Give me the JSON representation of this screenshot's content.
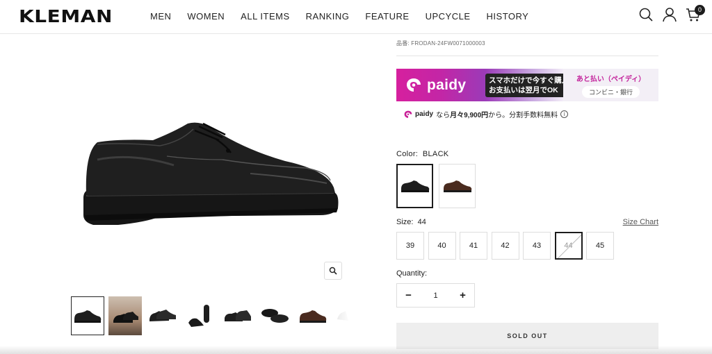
{
  "header": {
    "logo": "KLEMAN",
    "nav": [
      "MEN",
      "WOMEN",
      "ALL ITEMS",
      "RANKING",
      "FEATURE",
      "UPCYCLE",
      "HISTORY"
    ],
    "cart_count": "0",
    "icons": [
      "search-icon",
      "account-icon",
      "cart-icon"
    ]
  },
  "product": {
    "sku": "品番: FRODAN-24FW0071000003",
    "paidy": {
      "brand": "paidy",
      "promo_line1": "スマホだけで今すぐ購入",
      "promo_line2": "お支払いは翌月でOK",
      "label_atobarai": "あと払い（ペイディ）",
      "label_stores": "コンビニ・銀行",
      "line_brand": "paidy",
      "line_prefix": "なら",
      "line_amount": "月々9,900円",
      "line_suffix": "から。分割手数料無料"
    },
    "color_label": "Color:",
    "color_value": "BLACK",
    "colors": [
      "BLACK",
      "BROWN"
    ],
    "size_label": "Size:",
    "size_value": "44",
    "size_chart": "Size Chart",
    "sizes": [
      "39",
      "40",
      "41",
      "42",
      "43",
      "44",
      "45"
    ],
    "quantity_label": "Quantity:",
    "quantity_value": "1",
    "minus": "−",
    "plus": "+",
    "soldout": "SOLD OUT"
  },
  "colors": {
    "paidy_magenta": "#d6209e",
    "text": "#1c1c1c",
    "soldout_bg": "#eeeeee"
  }
}
